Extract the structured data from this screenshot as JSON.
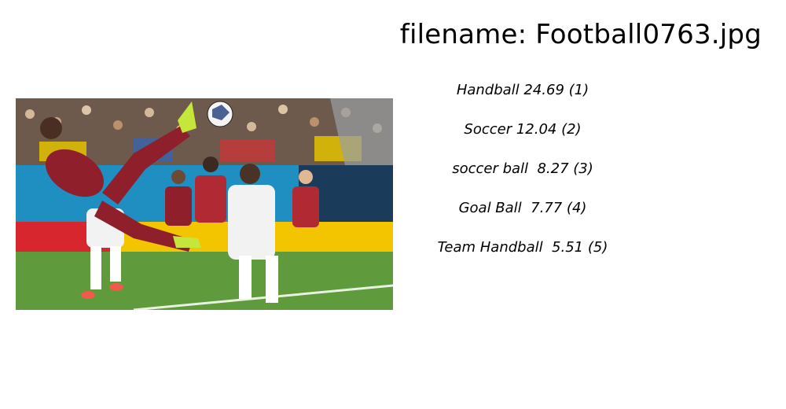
{
  "header": {
    "filename_label": "filename: Football0763.jpg"
  },
  "image": {
    "alt": "Soccer players in action; a player in a red kit performs an overhead kick while a player in white looks on",
    "colors": {
      "crowd": "#6e5a4c",
      "wall": "#1f8fc2",
      "banner_red": "#d8262f",
      "banner_yellow": "#f3c400",
      "grass": "#5f9a3c",
      "red_kit": "#8f1f2a",
      "white_kit": "#f2f2f2"
    }
  },
  "predictions": [
    {
      "label": "Handball 24.69 (1)"
    },
    {
      "label": "Soccer 12.04 (2)"
    },
    {
      "label": "soccer ball  8.27 (3)"
    },
    {
      "label": "Goal Ball  7.77 (4)"
    },
    {
      "label": "Team Handball  5.51 (5)"
    }
  ]
}
